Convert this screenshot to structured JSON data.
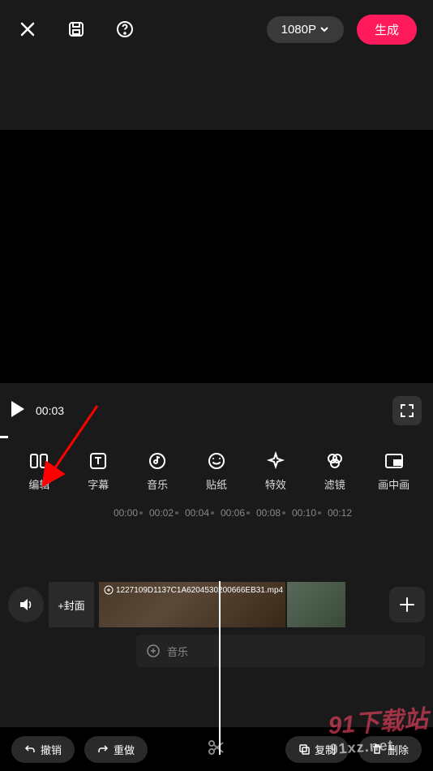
{
  "header": {
    "resolution": "1080P",
    "generate": "生成"
  },
  "playback": {
    "time": "00:03"
  },
  "tools": [
    {
      "label": "编辑"
    },
    {
      "label": "字幕"
    },
    {
      "label": "音乐"
    },
    {
      "label": "贴纸"
    },
    {
      "label": "特效"
    },
    {
      "label": "滤镜"
    },
    {
      "label": "画中画"
    }
  ],
  "ruler": [
    "00:00",
    "00:02",
    "00:04",
    "00:06",
    "00:08",
    "00:10",
    "00:12"
  ],
  "timeline": {
    "cover_label": "+封面",
    "clip_filename": "1227109D1137C1A6204530200666EB31.mp4",
    "music_label": "音乐"
  },
  "actions": {
    "undo": "撤销",
    "redo": "重做",
    "copy": "复制",
    "delete": "删除"
  },
  "watermark": {
    "top": "91下载站",
    "bottom": "91xz.net"
  }
}
